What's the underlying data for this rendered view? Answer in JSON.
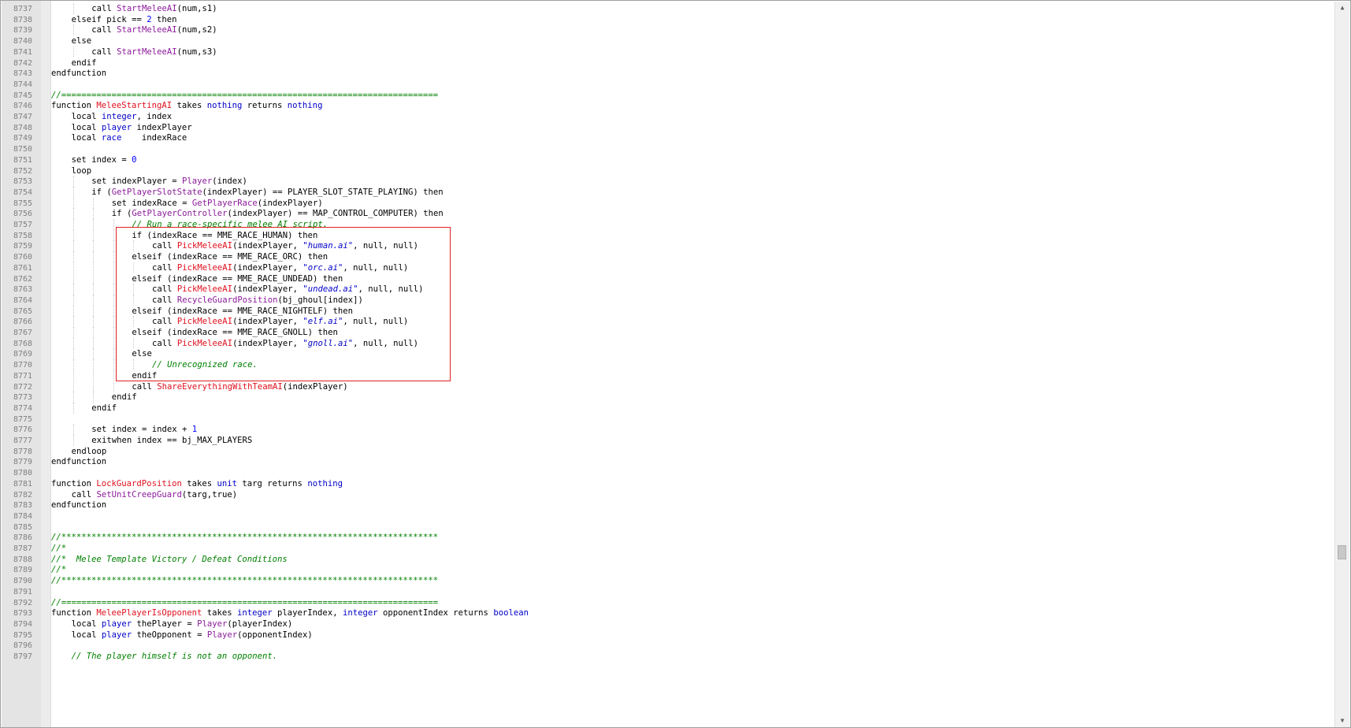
{
  "editor": {
    "first_line_number": 8737,
    "lines": [
      {
        "n": "8737",
        "indent": 2,
        "tokens": [
          [
            "kw",
            "call "
          ],
          [
            "nat",
            "StartMeleeAI"
          ],
          [
            "",
            "(num,s1)"
          ]
        ]
      },
      {
        "n": "8738",
        "indent": 1,
        "tokens": [
          [
            "kw",
            "elseif "
          ],
          [
            "",
            "pick == "
          ],
          [
            "num",
            "2"
          ],
          [
            "kw",
            " then"
          ]
        ]
      },
      {
        "n": "8739",
        "indent": 2,
        "tokens": [
          [
            "kw",
            "call "
          ],
          [
            "nat",
            "StartMeleeAI"
          ],
          [
            "",
            "(num,s2)"
          ]
        ]
      },
      {
        "n": "8740",
        "indent": 1,
        "tokens": [
          [
            "kw",
            "else"
          ]
        ]
      },
      {
        "n": "8741",
        "indent": 2,
        "tokens": [
          [
            "kw",
            "call "
          ],
          [
            "nat",
            "StartMeleeAI"
          ],
          [
            "",
            "(num,s3)"
          ]
        ]
      },
      {
        "n": "8742",
        "indent": 1,
        "tokens": [
          [
            "kw",
            "endif"
          ]
        ]
      },
      {
        "n": "8743",
        "indent": 0,
        "tokens": [
          [
            "kw",
            "endfunction"
          ]
        ]
      },
      {
        "n": "8744",
        "indent": 0,
        "tokens": []
      },
      {
        "n": "8745",
        "indent": 0,
        "tokens": [
          [
            "cm",
            "//==========================================================================="
          ]
        ]
      },
      {
        "n": "8746",
        "indent": 0,
        "tokens": [
          [
            "kw",
            "function "
          ],
          [
            "fn",
            "MeleeStartingAI"
          ],
          [
            "kw",
            " takes "
          ],
          [
            "ty",
            "nothing"
          ],
          [
            "kw",
            " returns "
          ],
          [
            "ty",
            "nothing"
          ]
        ]
      },
      {
        "n": "8747",
        "indent": 1,
        "tokens": [
          [
            "kw",
            "local "
          ],
          [
            "ty",
            "integer"
          ],
          [
            "",
            ", index"
          ]
        ]
      },
      {
        "n": "8748",
        "indent": 1,
        "tokens": [
          [
            "kw",
            "local "
          ],
          [
            "ty",
            "player"
          ],
          [
            "",
            " indexPlayer"
          ]
        ]
      },
      {
        "n": "8749",
        "indent": 1,
        "tokens": [
          [
            "kw",
            "local "
          ],
          [
            "ty",
            "race"
          ],
          [
            "",
            "    indexRace"
          ]
        ]
      },
      {
        "n": "8750",
        "indent": 0,
        "tokens": []
      },
      {
        "n": "8751",
        "indent": 1,
        "tokens": [
          [
            "kw",
            "set "
          ],
          [
            "",
            "index = "
          ],
          [
            "num",
            "0"
          ]
        ]
      },
      {
        "n": "8752",
        "indent": 1,
        "tokens": [
          [
            "kw",
            "loop"
          ]
        ]
      },
      {
        "n": "8753",
        "indent": 2,
        "tokens": [
          [
            "kw",
            "set "
          ],
          [
            "",
            "indexPlayer = "
          ],
          [
            "nat",
            "Player"
          ],
          [
            "",
            "(index)"
          ]
        ]
      },
      {
        "n": "8754",
        "indent": 2,
        "tokens": [
          [
            "kw",
            "if "
          ],
          [
            "",
            "("
          ],
          [
            "nat",
            "GetPlayerSlotState"
          ],
          [
            "",
            "(indexPlayer) == PLAYER_SLOT_STATE_PLAYING)"
          ],
          [
            "kw",
            " then"
          ]
        ]
      },
      {
        "n": "8755",
        "indent": 3,
        "tokens": [
          [
            "kw",
            "set "
          ],
          [
            "",
            "indexRace = "
          ],
          [
            "nat",
            "GetPlayerRace"
          ],
          [
            "",
            "(indexPlayer)"
          ]
        ]
      },
      {
        "n": "8756",
        "indent": 3,
        "tokens": [
          [
            "kw",
            "if "
          ],
          [
            "",
            "("
          ],
          [
            "nat",
            "GetPlayerController"
          ],
          [
            "",
            "(indexPlayer) == MAP_CONTROL_COMPUTER)"
          ],
          [
            "kw",
            " then"
          ]
        ]
      },
      {
        "n": "8757",
        "indent": 4,
        "tokens": [
          [
            "cm",
            "// Run a race-specific melee AI script."
          ]
        ]
      },
      {
        "n": "8758",
        "indent": 4,
        "tokens": [
          [
            "kw",
            "if "
          ],
          [
            "",
            "(indexRace == MME_RACE_HUMAN)"
          ],
          [
            "kw",
            " then"
          ]
        ]
      },
      {
        "n": "8759",
        "indent": 5,
        "tokens": [
          [
            "kw",
            "call "
          ],
          [
            "fn",
            "PickMeleeAI"
          ],
          [
            "",
            "(indexPlayer, "
          ],
          [
            "str",
            "\"human.ai\""
          ],
          [
            "",
            ", null, null)"
          ]
        ]
      },
      {
        "n": "8760",
        "indent": 4,
        "tokens": [
          [
            "kw",
            "elseif "
          ],
          [
            "",
            "(indexRace == MME_RACE_ORC)"
          ],
          [
            "kw",
            " then"
          ]
        ]
      },
      {
        "n": "8761",
        "indent": 5,
        "tokens": [
          [
            "kw",
            "call "
          ],
          [
            "fn",
            "PickMeleeAI"
          ],
          [
            "",
            "(indexPlayer, "
          ],
          [
            "str",
            "\"orc.ai\""
          ],
          [
            "",
            ", null, null)"
          ]
        ]
      },
      {
        "n": "8762",
        "indent": 4,
        "tokens": [
          [
            "kw",
            "elseif "
          ],
          [
            "",
            "(indexRace == MME_RACE_UNDEAD)"
          ],
          [
            "kw",
            " then"
          ]
        ]
      },
      {
        "n": "8763",
        "indent": 5,
        "tokens": [
          [
            "kw",
            "call "
          ],
          [
            "fn",
            "PickMeleeAI"
          ],
          [
            "",
            "(indexPlayer, "
          ],
          [
            "str",
            "\"undead.ai\""
          ],
          [
            "",
            ", null, null)"
          ]
        ]
      },
      {
        "n": "8764",
        "indent": 5,
        "tokens": [
          [
            "kw",
            "call "
          ],
          [
            "nat",
            "RecycleGuardPosition"
          ],
          [
            "",
            "(bj_ghoul[index])"
          ]
        ]
      },
      {
        "n": "8765",
        "indent": 4,
        "tokens": [
          [
            "kw",
            "elseif "
          ],
          [
            "",
            "(indexRace == MME_RACE_NIGHTELF)"
          ],
          [
            "kw",
            " then"
          ]
        ]
      },
      {
        "n": "8766",
        "indent": 5,
        "tokens": [
          [
            "kw",
            "call "
          ],
          [
            "fn",
            "PickMeleeAI"
          ],
          [
            "",
            "(indexPlayer, "
          ],
          [
            "str",
            "\"elf.ai\""
          ],
          [
            "",
            ", null, null)"
          ]
        ]
      },
      {
        "n": "8767",
        "indent": 4,
        "tokens": [
          [
            "kw",
            "elseif "
          ],
          [
            "",
            "(indexRace == MME_RACE_GNOLL)"
          ],
          [
            "kw",
            " then"
          ]
        ]
      },
      {
        "n": "8768",
        "indent": 5,
        "tokens": [
          [
            "kw",
            "call "
          ],
          [
            "fn",
            "PickMeleeAI"
          ],
          [
            "",
            "(indexPlayer, "
          ],
          [
            "str",
            "\"gnoll.ai\""
          ],
          [
            "",
            ", null, null)"
          ]
        ]
      },
      {
        "n": "8769",
        "indent": 4,
        "tokens": [
          [
            "kw",
            "else"
          ]
        ]
      },
      {
        "n": "8770",
        "indent": 5,
        "tokens": [
          [
            "cm",
            "// Unrecognized race."
          ]
        ]
      },
      {
        "n": "8771",
        "indent": 4,
        "tokens": [
          [
            "kw",
            "endif"
          ]
        ]
      },
      {
        "n": "8772",
        "indent": 4,
        "tokens": [
          [
            "kw",
            "call "
          ],
          [
            "fn",
            "ShareEverythingWithTeamAI"
          ],
          [
            "",
            "(indexPlayer)"
          ]
        ]
      },
      {
        "n": "8773",
        "indent": 3,
        "tokens": [
          [
            "kw",
            "endif"
          ]
        ]
      },
      {
        "n": "8774",
        "indent": 2,
        "tokens": [
          [
            "kw",
            "endif"
          ]
        ]
      },
      {
        "n": "8775",
        "indent": 0,
        "tokens": []
      },
      {
        "n": "8776",
        "indent": 2,
        "tokens": [
          [
            "kw",
            "set "
          ],
          [
            "",
            "index = index + "
          ],
          [
            "num",
            "1"
          ]
        ]
      },
      {
        "n": "8777",
        "indent": 2,
        "tokens": [
          [
            "kw",
            "exitwhen "
          ],
          [
            "",
            "index == bj_MAX_PLAYERS"
          ]
        ]
      },
      {
        "n": "8778",
        "indent": 1,
        "tokens": [
          [
            "kw",
            "endloop"
          ]
        ]
      },
      {
        "n": "8779",
        "indent": 0,
        "tokens": [
          [
            "kw",
            "endfunction"
          ]
        ]
      },
      {
        "n": "8780",
        "indent": 0,
        "tokens": []
      },
      {
        "n": "8781",
        "indent": 0,
        "tokens": [
          [
            "kw",
            "function "
          ],
          [
            "fn",
            "LockGuardPosition"
          ],
          [
            "kw",
            " takes "
          ],
          [
            "ty",
            "unit"
          ],
          [
            "",
            " targ"
          ],
          [
            "kw",
            " returns "
          ],
          [
            "ty",
            "nothing"
          ]
        ]
      },
      {
        "n": "8782",
        "indent": 1,
        "tokens": [
          [
            "kw",
            "call "
          ],
          [
            "nat",
            "SetUnitCreepGuard"
          ],
          [
            "",
            "(targ,true)"
          ]
        ]
      },
      {
        "n": "8783",
        "indent": 0,
        "tokens": [
          [
            "kw",
            "endfunction"
          ]
        ]
      },
      {
        "n": "8784",
        "indent": 0,
        "tokens": []
      },
      {
        "n": "8785",
        "indent": 0,
        "tokens": []
      },
      {
        "n": "8786",
        "indent": 0,
        "tokens": [
          [
            "cm",
            "//***************************************************************************"
          ]
        ]
      },
      {
        "n": "8787",
        "indent": 0,
        "tokens": [
          [
            "cm",
            "//*"
          ]
        ]
      },
      {
        "n": "8788",
        "indent": 0,
        "tokens": [
          [
            "cm",
            "//*  Melee Template Victory / Defeat Conditions"
          ]
        ]
      },
      {
        "n": "8789",
        "indent": 0,
        "tokens": [
          [
            "cm",
            "//*"
          ]
        ]
      },
      {
        "n": "8790",
        "indent": 0,
        "tokens": [
          [
            "cm",
            "//***************************************************************************"
          ]
        ]
      },
      {
        "n": "8791",
        "indent": 0,
        "tokens": []
      },
      {
        "n": "8792",
        "indent": 0,
        "tokens": [
          [
            "cm",
            "//==========================================================================="
          ]
        ]
      },
      {
        "n": "8793",
        "indent": 0,
        "tokens": [
          [
            "kw",
            "function "
          ],
          [
            "fn",
            "MeleePlayerIsOpponent"
          ],
          [
            "kw",
            " takes "
          ],
          [
            "ty",
            "integer"
          ],
          [
            "",
            " playerIndex, "
          ],
          [
            "ty",
            "integer"
          ],
          [
            "",
            " opponentIndex"
          ],
          [
            "kw",
            " returns "
          ],
          [
            "ty",
            "boolean"
          ]
        ]
      },
      {
        "n": "8794",
        "indent": 1,
        "tokens": [
          [
            "kw",
            "local "
          ],
          [
            "ty",
            "player"
          ],
          [
            "",
            " thePlayer = "
          ],
          [
            "nat",
            "Player"
          ],
          [
            "",
            "(playerIndex)"
          ]
        ]
      },
      {
        "n": "8795",
        "indent": 1,
        "tokens": [
          [
            "kw",
            "local "
          ],
          [
            "ty",
            "player"
          ],
          [
            "",
            " theOpponent = "
          ],
          [
            "nat",
            "Player"
          ],
          [
            "",
            "(opponentIndex)"
          ]
        ]
      },
      {
        "n": "8796",
        "indent": 0,
        "tokens": []
      },
      {
        "n": "8797",
        "indent": 1,
        "tokens": [
          [
            "cm",
            "// The player himself is not an opponent."
          ]
        ]
      }
    ]
  },
  "colors": {
    "keyword": "#000000",
    "type": "#0000c8",
    "function_name": "#e0101e",
    "native_call": "#8b1a9a",
    "number": "#0000ff",
    "string": "#0000c8",
    "comment": "#008000",
    "highlight_border": "#e02020"
  },
  "icons": {
    "scroll_up": "triangle-up",
    "scroll_down": "triangle-down"
  }
}
